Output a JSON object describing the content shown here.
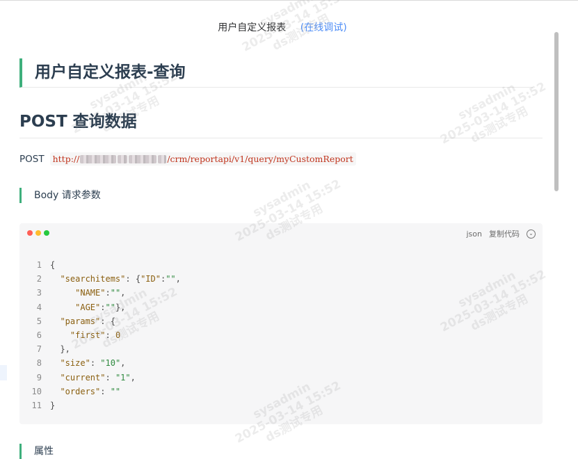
{
  "header": {
    "page_title": "用户自定义报表",
    "debug_link": "(在线调试)"
  },
  "doc": {
    "h1": "用户自定义报表-查询",
    "h2": "POST 查询数据",
    "method": "POST",
    "url_prefix": "http://",
    "url_path": "/crm/reportapi/v1/query/myCustomReport",
    "body_heading": "Body 请求参数",
    "next_heading": "属性"
  },
  "code_block": {
    "language": "json",
    "copy_label": "复制代码",
    "lines": [
      {
        "n": "1",
        "parts": [
          {
            "t": "{",
            "c": "ct"
          }
        ]
      },
      {
        "n": "2",
        "parts": [
          {
            "t": "  ",
            "c": "ct"
          },
          {
            "t": "\"searchitems\"",
            "c": "k"
          },
          {
            "t": ": {",
            "c": "ct"
          },
          {
            "t": "\"ID\"",
            "c": "k"
          },
          {
            "t": ":",
            "c": "ct"
          },
          {
            "t": "\"\"",
            "c": "s"
          },
          {
            "t": ",",
            "c": "ct"
          }
        ]
      },
      {
        "n": "3",
        "parts": [
          {
            "t": "     ",
            "c": "ct"
          },
          {
            "t": "\"NAME\"",
            "c": "k"
          },
          {
            "t": ":",
            "c": "ct"
          },
          {
            "t": "\"\"",
            "c": "s"
          },
          {
            "t": ",",
            "c": "ct"
          }
        ]
      },
      {
        "n": "4",
        "parts": [
          {
            "t": "     ",
            "c": "ct"
          },
          {
            "t": "\"AGE\"",
            "c": "k"
          },
          {
            "t": ":",
            "c": "ct"
          },
          {
            "t": "\"\"",
            "c": "s"
          },
          {
            "t": "},",
            "c": "ct"
          }
        ]
      },
      {
        "n": "5",
        "parts": [
          {
            "t": "  ",
            "c": "ct"
          },
          {
            "t": "\"params\"",
            "c": "k"
          },
          {
            "t": ": {",
            "c": "ct"
          }
        ]
      },
      {
        "n": "6",
        "parts": [
          {
            "t": "    ",
            "c": "ct"
          },
          {
            "t": "\"first\"",
            "c": "k"
          },
          {
            "t": ": ",
            "c": "ct"
          },
          {
            "t": "0",
            "c": "n"
          }
        ]
      },
      {
        "n": "7",
        "parts": [
          {
            "t": "  },",
            "c": "ct"
          }
        ]
      },
      {
        "n": "8",
        "parts": [
          {
            "t": "  ",
            "c": "ct"
          },
          {
            "t": "\"size\"",
            "c": "k"
          },
          {
            "t": ": ",
            "c": "ct"
          },
          {
            "t": "\"10\"",
            "c": "s"
          },
          {
            "t": ",",
            "c": "ct"
          }
        ]
      },
      {
        "n": "9",
        "parts": [
          {
            "t": "  ",
            "c": "ct"
          },
          {
            "t": "\"current\"",
            "c": "k"
          },
          {
            "t": ": ",
            "c": "ct"
          },
          {
            "t": "\"1\"",
            "c": "s"
          },
          {
            "t": ",",
            "c": "ct"
          }
        ]
      },
      {
        "n": "10",
        "parts": [
          {
            "t": "  ",
            "c": "ct"
          },
          {
            "t": "\"orders\"",
            "c": "k"
          },
          {
            "t": ": ",
            "c": "ct"
          },
          {
            "t": "\"\"",
            "c": "s"
          }
        ]
      },
      {
        "n": "11",
        "parts": [
          {
            "t": "}",
            "c": "ct"
          }
        ]
      }
    ]
  },
  "watermark": {
    "user": "sysadmin",
    "datetime": "2025-03-14 15:52",
    "org": "ds测试专用"
  },
  "colors": {
    "accent": "#3eaf7c",
    "link": "#4f8ef7",
    "url_text": "#c0341d"
  }
}
